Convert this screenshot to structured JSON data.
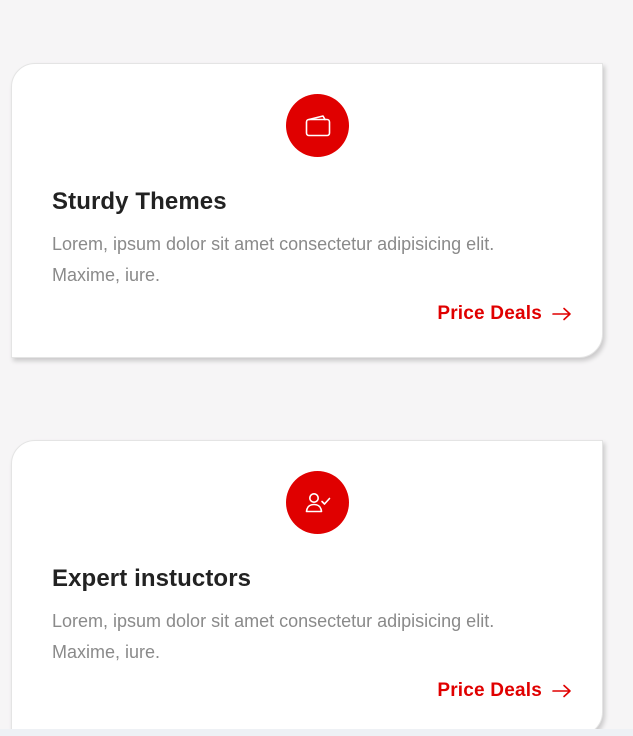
{
  "colors": {
    "accent": "#e00000",
    "background": "#f6f5f6",
    "card_background": "#ffffff",
    "title": "#222222",
    "body_text": "#8a8a8a"
  },
  "cards": [
    {
      "icon": "wallet-icon",
      "title": "Sturdy Themes",
      "text": "Lorem, ipsum dolor sit amet consectetur adipisicing elit. Maxime, iure.",
      "link_label": "Price Deals",
      "link_icon": "arrow-right-icon"
    },
    {
      "icon": "user-check-icon",
      "title": "Expert instuctors",
      "text": "Lorem, ipsum dolor sit amet consectetur adipisicing elit. Maxime, iure.",
      "link_label": "Price Deals",
      "link_icon": "arrow-right-icon"
    }
  ]
}
